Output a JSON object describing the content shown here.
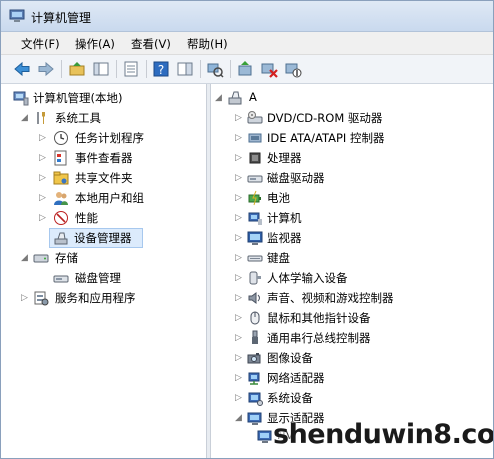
{
  "window": {
    "title": "计算机管理"
  },
  "menu": [
    "文件(F)",
    "操作(A)",
    "查看(V)",
    "帮助(H)"
  ],
  "left_tree": {
    "root": "计算机管理(本地)",
    "system_tools": "系统工具",
    "task_scheduler": "任务计划程序",
    "event_viewer": "事件查看器",
    "shared_folders": "共享文件夹",
    "local_users": "本地用户和组",
    "performance": "性能",
    "device_manager": "设备管理器",
    "storage": "存储",
    "disk_management": "磁盘管理",
    "services_apps": "服务和应用程序"
  },
  "right_tree": {
    "root": "A",
    "items": [
      "DVD/CD-ROM 驱动器",
      "IDE ATA/ATAPI 控制器",
      "处理器",
      "磁盘驱动器",
      "电池",
      "计算机",
      "监视器",
      "键盘",
      "人体学输入设备",
      "声音、视频和游戏控制器",
      "鼠标和其他指针设备",
      "通用串行总线控制器",
      "图像设备",
      "网络适配器",
      "系统设备",
      "显示适配器"
    ],
    "child": "NV"
  },
  "watermark": "shenduwin8.com"
}
